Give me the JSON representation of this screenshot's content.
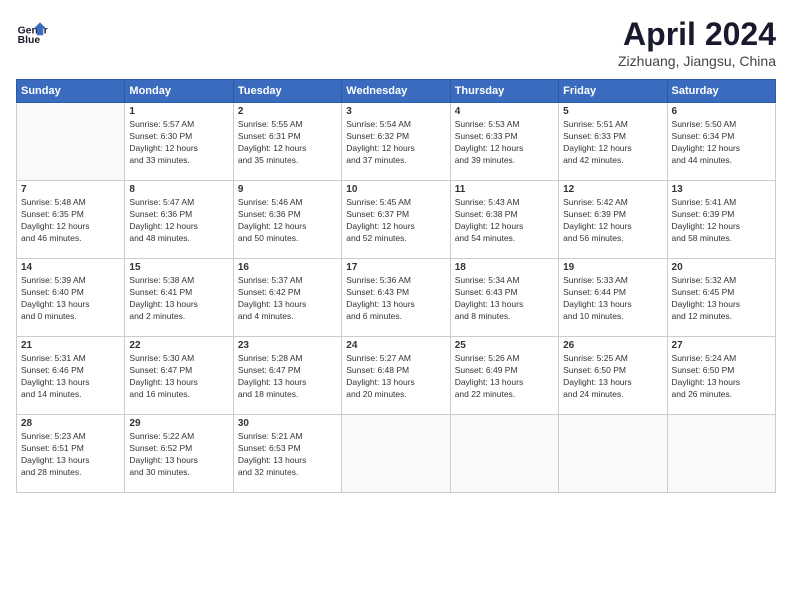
{
  "logo": {
    "line1": "General",
    "line2": "Blue"
  },
  "title": "April 2024",
  "location": "Zizhuang, Jiangsu, China",
  "days_header": [
    "Sunday",
    "Monday",
    "Tuesday",
    "Wednesday",
    "Thursday",
    "Friday",
    "Saturday"
  ],
  "weeks": [
    [
      {
        "num": "",
        "empty": true
      },
      {
        "num": "1",
        "sunrise": "5:57 AM",
        "sunset": "6:30 PM",
        "daylight": "12 hours and 33 minutes."
      },
      {
        "num": "2",
        "sunrise": "5:55 AM",
        "sunset": "6:31 PM",
        "daylight": "12 hours and 35 minutes."
      },
      {
        "num": "3",
        "sunrise": "5:54 AM",
        "sunset": "6:32 PM",
        "daylight": "12 hours and 37 minutes."
      },
      {
        "num": "4",
        "sunrise": "5:53 AM",
        "sunset": "6:33 PM",
        "daylight": "12 hours and 39 minutes."
      },
      {
        "num": "5",
        "sunrise": "5:51 AM",
        "sunset": "6:33 PM",
        "daylight": "12 hours and 42 minutes."
      },
      {
        "num": "6",
        "sunrise": "5:50 AM",
        "sunset": "6:34 PM",
        "daylight": "12 hours and 44 minutes."
      }
    ],
    [
      {
        "num": "7",
        "sunrise": "5:48 AM",
        "sunset": "6:35 PM",
        "daylight": "12 hours and 46 minutes."
      },
      {
        "num": "8",
        "sunrise": "5:47 AM",
        "sunset": "6:36 PM",
        "daylight": "12 hours and 48 minutes."
      },
      {
        "num": "9",
        "sunrise": "5:46 AM",
        "sunset": "6:36 PM",
        "daylight": "12 hours and 50 minutes."
      },
      {
        "num": "10",
        "sunrise": "5:45 AM",
        "sunset": "6:37 PM",
        "daylight": "12 hours and 52 minutes."
      },
      {
        "num": "11",
        "sunrise": "5:43 AM",
        "sunset": "6:38 PM",
        "daylight": "12 hours and 54 minutes."
      },
      {
        "num": "12",
        "sunrise": "5:42 AM",
        "sunset": "6:39 PM",
        "daylight": "12 hours and 56 minutes."
      },
      {
        "num": "13",
        "sunrise": "5:41 AM",
        "sunset": "6:39 PM",
        "daylight": "12 hours and 58 minutes."
      }
    ],
    [
      {
        "num": "14",
        "sunrise": "5:39 AM",
        "sunset": "6:40 PM",
        "daylight": "13 hours and 0 minutes."
      },
      {
        "num": "15",
        "sunrise": "5:38 AM",
        "sunset": "6:41 PM",
        "daylight": "13 hours and 2 minutes."
      },
      {
        "num": "16",
        "sunrise": "5:37 AM",
        "sunset": "6:42 PM",
        "daylight": "13 hours and 4 minutes."
      },
      {
        "num": "17",
        "sunrise": "5:36 AM",
        "sunset": "6:43 PM",
        "daylight": "13 hours and 6 minutes."
      },
      {
        "num": "18",
        "sunrise": "5:34 AM",
        "sunset": "6:43 PM",
        "daylight": "13 hours and 8 minutes."
      },
      {
        "num": "19",
        "sunrise": "5:33 AM",
        "sunset": "6:44 PM",
        "daylight": "13 hours and 10 minutes."
      },
      {
        "num": "20",
        "sunrise": "5:32 AM",
        "sunset": "6:45 PM",
        "daylight": "13 hours and 12 minutes."
      }
    ],
    [
      {
        "num": "21",
        "sunrise": "5:31 AM",
        "sunset": "6:46 PM",
        "daylight": "13 hours and 14 minutes."
      },
      {
        "num": "22",
        "sunrise": "5:30 AM",
        "sunset": "6:47 PM",
        "daylight": "13 hours and 16 minutes."
      },
      {
        "num": "23",
        "sunrise": "5:28 AM",
        "sunset": "6:47 PM",
        "daylight": "13 hours and 18 minutes."
      },
      {
        "num": "24",
        "sunrise": "5:27 AM",
        "sunset": "6:48 PM",
        "daylight": "13 hours and 20 minutes."
      },
      {
        "num": "25",
        "sunrise": "5:26 AM",
        "sunset": "6:49 PM",
        "daylight": "13 hours and 22 minutes."
      },
      {
        "num": "26",
        "sunrise": "5:25 AM",
        "sunset": "6:50 PM",
        "daylight": "13 hours and 24 minutes."
      },
      {
        "num": "27",
        "sunrise": "5:24 AM",
        "sunset": "6:50 PM",
        "daylight": "13 hours and 26 minutes."
      }
    ],
    [
      {
        "num": "28",
        "sunrise": "5:23 AM",
        "sunset": "6:51 PM",
        "daylight": "13 hours and 28 minutes."
      },
      {
        "num": "29",
        "sunrise": "5:22 AM",
        "sunset": "6:52 PM",
        "daylight": "13 hours and 30 minutes."
      },
      {
        "num": "30",
        "sunrise": "5:21 AM",
        "sunset": "6:53 PM",
        "daylight": "13 hours and 32 minutes."
      },
      {
        "num": "",
        "empty": true
      },
      {
        "num": "",
        "empty": true
      },
      {
        "num": "",
        "empty": true
      },
      {
        "num": "",
        "empty": true
      }
    ]
  ]
}
